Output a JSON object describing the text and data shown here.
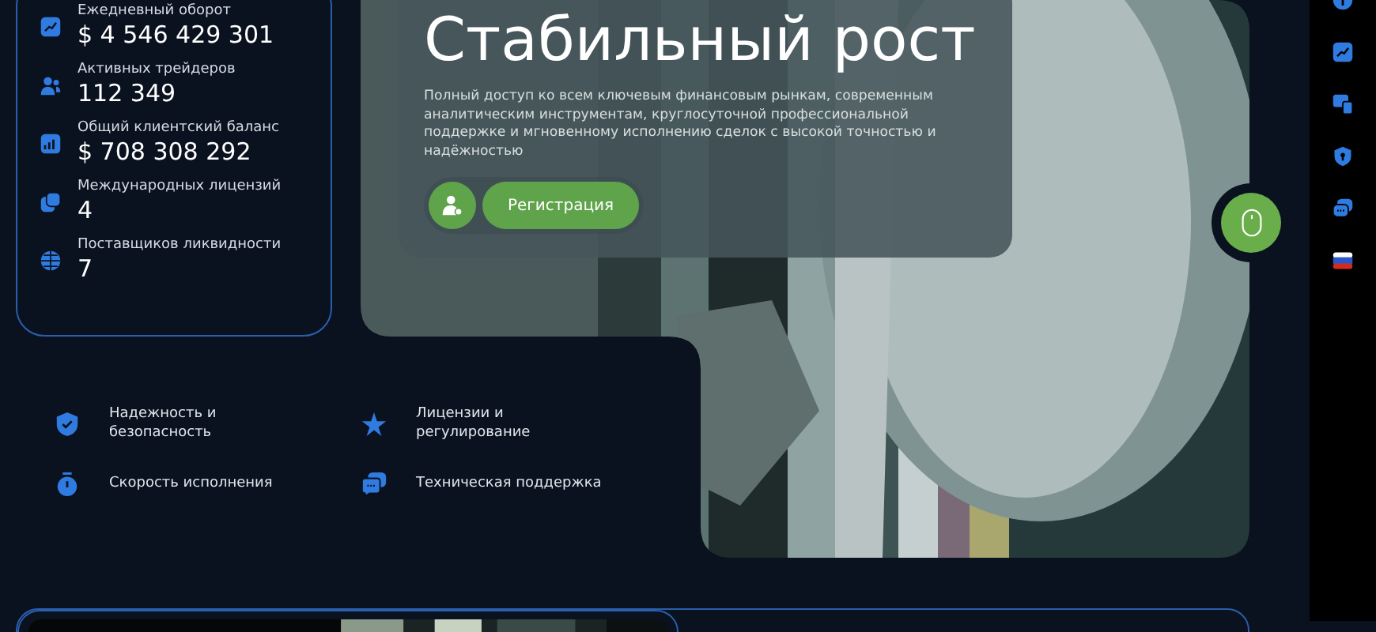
{
  "stats": [
    {
      "label": "Ежедневный оборот",
      "value": "$ 4 546 429 301"
    },
    {
      "label": "Активных трейдеров",
      "value": "112 349"
    },
    {
      "label": "Общий клиентский баланс",
      "value": "$ 708 308 292"
    },
    {
      "label": "Международных лицензий",
      "value": "4"
    },
    {
      "label": "Поставщиков ликвидности",
      "value": "7"
    }
  ],
  "hero": {
    "title": "Стабильный рост",
    "description": "Полный доступ ко всем ключевым финансовым рынкам, современным аналитическим инструментам, круглосуточной профессиональной поддержке и мгновенному исполнению сделок с высокой точностью и надёжностью",
    "button": "Регистрация"
  },
  "features": [
    {
      "label": "Надежность и безопасность"
    },
    {
      "label": "Лицензии и регулирование"
    },
    {
      "label": "Скорость исполнения"
    },
    {
      "label": "Техническая поддержка"
    }
  ]
}
